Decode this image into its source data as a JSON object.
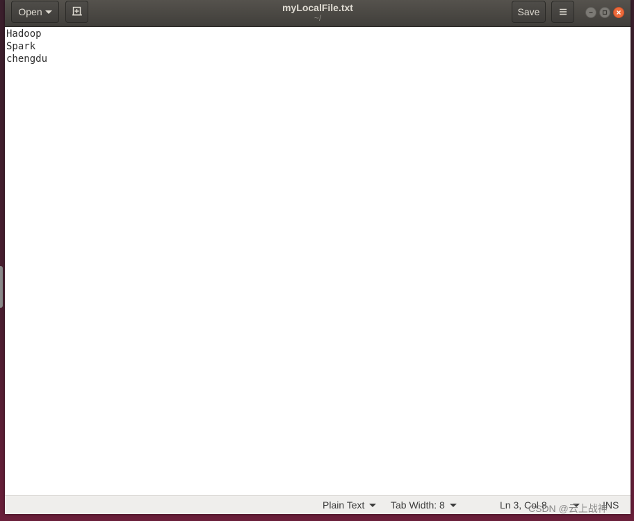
{
  "window": {
    "title": "myLocalFile.txt",
    "subtitle": "~/"
  },
  "headerbar": {
    "open_label": "Open",
    "save_label": "Save",
    "new_document_icon": "new-document-icon",
    "menu_icon": "hamburger-menu-icon",
    "window_controls": [
      "minimize-icon",
      "maximize-icon",
      "close-icon"
    ]
  },
  "editor": {
    "lines": [
      "Hadoop",
      "Spark",
      "chengdu"
    ]
  },
  "statusbar": {
    "language": "Plain Text",
    "tab_width": "Tab Width: 8",
    "cursor_position": "Ln 3, Col 8",
    "insert_mode": "INS"
  },
  "watermark": "CSDN @云上战神",
  "colors": {
    "headerbar": "#403e3a",
    "close_button": "#ec6a3a",
    "statusbar": "#efeeec",
    "desktop": "#4a1e30"
  }
}
